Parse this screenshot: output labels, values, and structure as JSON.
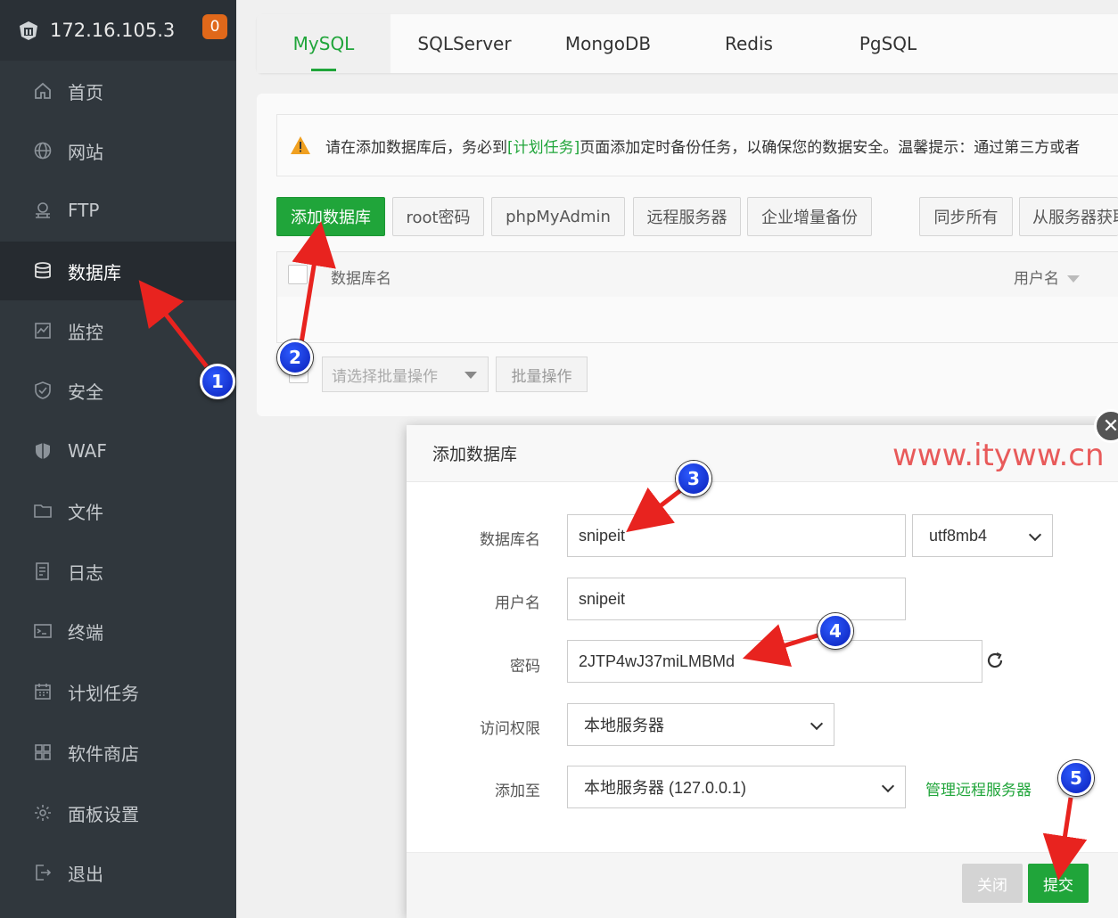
{
  "sidebar": {
    "server_ip": "172.16.105.3",
    "badge_count": "0",
    "items": [
      {
        "label": "首页",
        "icon": "home-icon"
      },
      {
        "label": "网站",
        "icon": "globe-icon"
      },
      {
        "label": "FTP",
        "icon": "ftp-icon"
      },
      {
        "label": "数据库",
        "icon": "database-icon"
      },
      {
        "label": "监控",
        "icon": "monitor-icon"
      },
      {
        "label": "安全",
        "icon": "shield-icon"
      },
      {
        "label": "WAF",
        "icon": "waf-icon"
      },
      {
        "label": "文件",
        "icon": "folder-icon"
      },
      {
        "label": "日志",
        "icon": "log-icon"
      },
      {
        "label": "终端",
        "icon": "terminal-icon"
      },
      {
        "label": "计划任务",
        "icon": "calendar-icon"
      },
      {
        "label": "软件商店",
        "icon": "apps-icon"
      },
      {
        "label": "面板设置",
        "icon": "gear-icon"
      },
      {
        "label": "退出",
        "icon": "logout-icon"
      }
    ],
    "active_index": 3
  },
  "tabs": [
    "MySQL",
    "SQLServer",
    "MongoDB",
    "Redis",
    "PgSQL"
  ],
  "notice": {
    "before": "请在添加数据库后，务必到",
    "link": "[计划任务]",
    "after": "页面添加定时备份任务，以确保您的数据安全。温馨提示：通过第三方或者"
  },
  "toolbar": {
    "add_db": "添加数据库",
    "root_pwd": "root密码",
    "phpmyadmin": "phpMyAdmin",
    "remote_server": "远程服务器",
    "enterprise_backup": "企业增量备份",
    "sync_all": "同步所有",
    "fetch_from_server": "从服务器获取"
  },
  "table": {
    "col_name": "数据库名",
    "col_user": "用户名"
  },
  "batch": {
    "select_placeholder": "请选择批量操作",
    "button": "批量操作"
  },
  "dialog": {
    "title": "添加数据库",
    "watermark": "www.ityww.cn",
    "db_name_label": "数据库名",
    "db_name_value": "snipeit",
    "charset_value": "utf8mb4",
    "username_label": "用户名",
    "username_value": "snipeit",
    "password_label": "密码",
    "password_value": "2JTP4wJ37miLMBMd",
    "access_label": "访问权限",
    "access_value": "本地服务器",
    "add_to_label": "添加至",
    "add_to_value": "本地服务器 (127.0.0.1)",
    "manage_remote_link": "管理远程服务器",
    "close_button": "关闭",
    "submit_button": "提交"
  },
  "annotations": [
    "1",
    "2",
    "3",
    "4",
    "5"
  ],
  "colors": {
    "accent": "#20a53a",
    "sidebar_bg": "#30373d",
    "badge": "#e0681a",
    "arrow": "#e8231f",
    "marker": "#1535d9"
  }
}
